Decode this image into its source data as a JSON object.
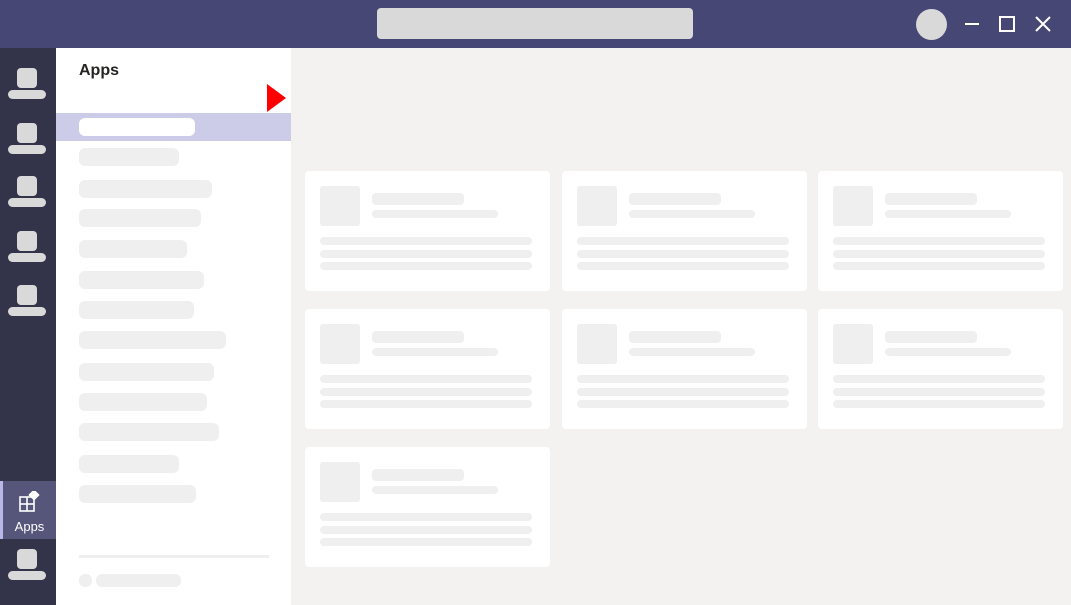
{
  "titlebar": {
    "search_placeholder_icon": "search-skeleton",
    "window_controls": [
      "minimize-icon",
      "maximize-icon",
      "close-icon"
    ]
  },
  "rail": {
    "apps_label": "Apps",
    "apps_icon": "apps-icon"
  },
  "panel": {
    "title": "Apps"
  },
  "colors": {
    "titlebar": "#464775",
    "rail": "#33344a",
    "selected": "#cccce9",
    "marker": "#ff0000"
  }
}
